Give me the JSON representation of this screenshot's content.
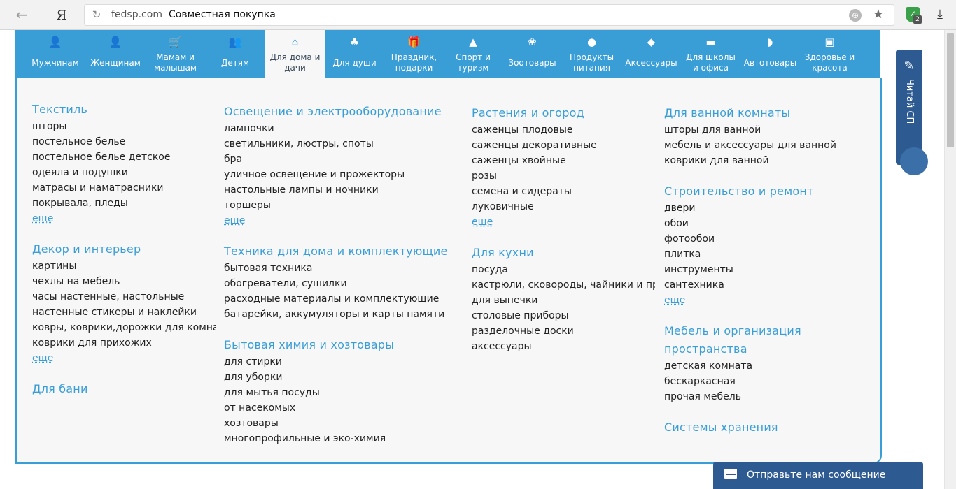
{
  "browser": {
    "back_icon": "←",
    "yandex_label": "Я",
    "host": "fedsp.com",
    "title": "Совместная покупка",
    "reload_icon": "↻",
    "globe_icon": "⊕",
    "star_icon": "★",
    "ext_badge": "2",
    "download_icon": "⤓"
  },
  "menu": [
    {
      "label": "Мужчинам",
      "icon": "man-icon",
      "glyph": "👤",
      "active": false
    },
    {
      "label": "Женщинам",
      "icon": "woman-icon",
      "glyph": "👤",
      "active": false
    },
    {
      "label": "Мамам и малышам",
      "icon": "stroller-icon",
      "glyph": "🛒",
      "active": false
    },
    {
      "label": "Детям",
      "icon": "children-icon",
      "glyph": "👥",
      "active": false
    },
    {
      "label": "Для дома и дачи",
      "icon": "home-icon",
      "glyph": "⌂",
      "active": true
    },
    {
      "label": "Для души",
      "icon": "yoga-icon",
      "glyph": "♣",
      "active": false
    },
    {
      "label": "Праздник, подарки",
      "icon": "gift-icon",
      "glyph": "🎁",
      "active": false
    },
    {
      "label": "Спорт и туризм",
      "icon": "tent-icon",
      "glyph": "▲",
      "active": false
    },
    {
      "label": "Зоотовары",
      "icon": "paw-icon",
      "glyph": "❀",
      "active": false
    },
    {
      "label": "Продукты питания",
      "icon": "apple-icon",
      "glyph": "●",
      "active": false
    },
    {
      "label": "Аксессуары",
      "icon": "accessories-icon",
      "glyph": "◆",
      "active": false
    },
    {
      "label": "Для школы и офиса",
      "icon": "briefcase-icon",
      "glyph": "▬",
      "active": false
    },
    {
      "label": "Автотовары",
      "icon": "car-icon",
      "glyph": "◗",
      "active": false
    },
    {
      "label": "Здоровье и красота",
      "icon": "box-icon",
      "glyph": "▣",
      "active": false
    }
  ],
  "columns": [
    {
      "sections": [
        {
          "head": "Текстиль",
          "links": [
            "шторы",
            "постельное белье",
            "постельное белье детское",
            "одеяла и подушки",
            "матрасы и наматрасники",
            "покрывала, пледы"
          ],
          "more": "еще"
        },
        {
          "head": "Декор и интерьер",
          "links": [
            "картины",
            "чехлы на мебель",
            "часы настенные, настольные",
            "настенные стикеры и наклейки",
            "ковры, коврики,дорожки для комнат",
            "коврики для прихожих"
          ],
          "more": "еще"
        },
        {
          "head": "Для бани",
          "links": [],
          "more": ""
        }
      ]
    },
    {
      "sections": [
        {
          "head": "Освещение и электрооборудование",
          "links": [
            "лампочки",
            "светильники, люстры, споты",
            "бра",
            "уличное освещение и прожекторы",
            "настольные лампы и ночники",
            "торшеры"
          ],
          "more": "еще"
        },
        {
          "head": "Техника для дома и комплектующие",
          "links": [
            "бытовая техника",
            "обогреватели, сушилки",
            "расходные материалы и комплектующие",
            "батарейки, аккумуляторы и карты памяти"
          ],
          "more": ""
        },
        {
          "head": "Бытовая химия и хозтовары",
          "links": [
            "для стирки",
            "для уборки",
            "для мытья посуды",
            "от насекомых",
            "хозтовары",
            "многопрофильные и эко-химия"
          ],
          "more": ""
        }
      ]
    },
    {
      "sections": [
        {
          "head": "Растения и огород",
          "links": [
            "саженцы плодовые",
            "саженцы декоративные",
            "саженцы хвойные",
            "розы",
            "семена и сидераты",
            "луковичные"
          ],
          "more": "еще"
        },
        {
          "head": "Для кухни",
          "links": [
            "посуда",
            "кастрюли, сковороды, чайники и пр",
            "для выпечки",
            "столовые приборы",
            "разделочные доски",
            "аксессуары"
          ],
          "more": ""
        }
      ]
    },
    {
      "sections": [
        {
          "head": "Для ванной комнаты",
          "links": [
            "шторы для ванной",
            "мебель и аксессуары для ванной",
            "коврики для ванной"
          ],
          "more": ""
        },
        {
          "head": "Строительство и ремонт",
          "links": [
            "двери",
            "обои",
            "фотообои",
            "плитка",
            "инструменты",
            "сантехника"
          ],
          "more": "еще"
        },
        {
          "head": "Мебель и организация пространства",
          "links": [
            "детская комната",
            "бескаркасная",
            "прочая мебель"
          ],
          "more": ""
        },
        {
          "head": "Системы хранения",
          "links": [],
          "more": ""
        }
      ]
    }
  ],
  "side_tab": {
    "label": "Читай СП",
    "icon": "pen-icon"
  },
  "message_bar": {
    "label": "Отправьте нам сообщение",
    "icon": "envelope-icon"
  },
  "colors": {
    "accent": "#3a9ed6",
    "dark_blue": "#2d5b91",
    "panel_bg": "#f7f7f7"
  }
}
